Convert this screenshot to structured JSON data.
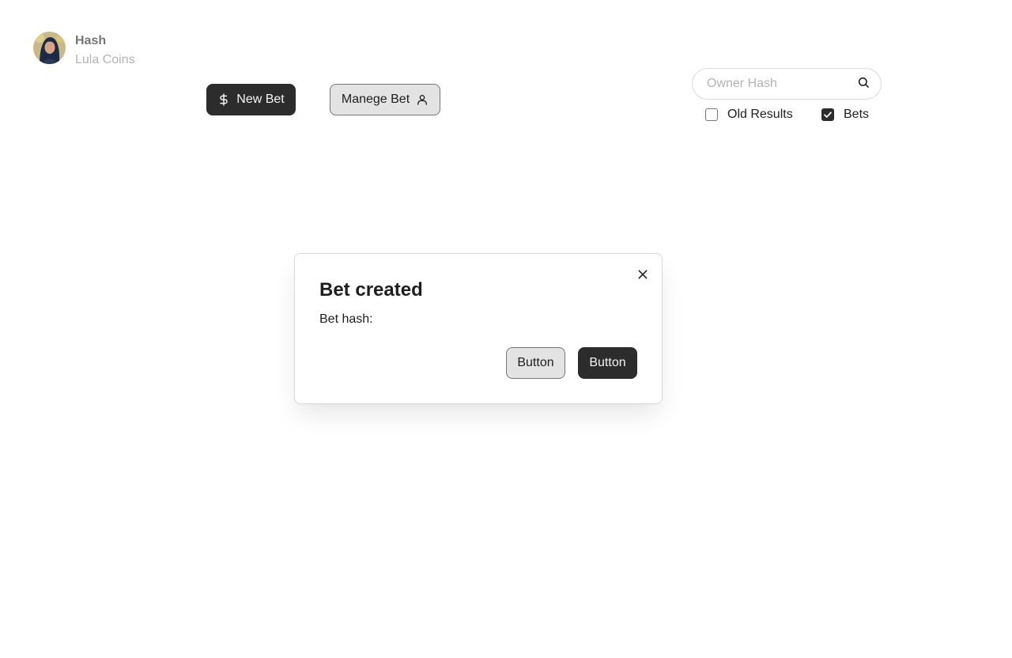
{
  "user": {
    "name": "Hash",
    "subtitle": "Lula Coins",
    "avatar_icon": "user-photo-avatar"
  },
  "toolbar": {
    "new_bet_label": "New Bet",
    "new_bet_icon": "dollar-sign-icon",
    "manage_bet_label": "Manege Bet",
    "manage_bet_icon": "user-icon"
  },
  "search": {
    "placeholder": "Owner Hash",
    "value": "",
    "icon": "search-icon"
  },
  "filters": [
    {
      "label": "Old Results",
      "checked": false
    },
    {
      "label": "Bets",
      "checked": true
    }
  ],
  "dialog": {
    "title": "Bet created",
    "body": "Bet hash:",
    "secondary_button": "Button",
    "primary_button": "Button",
    "close_icon": "close-icon"
  },
  "colors": {
    "primary": "#2c2c2c",
    "secondary_bg": "#e3e3e3",
    "border": "#d9d9d9",
    "muted_text": "#b3b3b3"
  }
}
